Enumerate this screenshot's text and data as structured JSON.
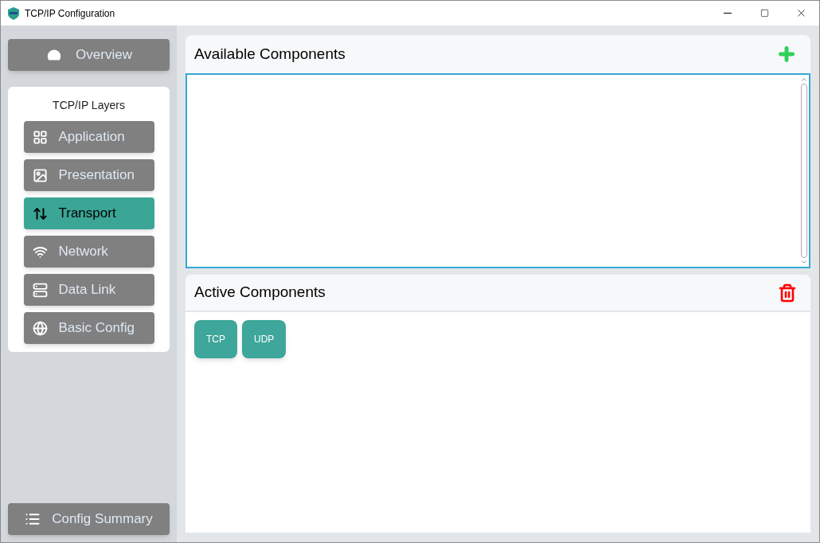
{
  "window": {
    "title": "TCP/IP Configuration"
  },
  "sidebar": {
    "overview": "Overview",
    "layers_title": "TCP/IP Layers",
    "layers": [
      {
        "label": "Application",
        "kind": "grid",
        "selected": false
      },
      {
        "label": "Presentation",
        "kind": "image",
        "selected": false
      },
      {
        "label": "Transport",
        "kind": "arrows",
        "selected": true
      },
      {
        "label": "Network",
        "kind": "wifi",
        "selected": false
      },
      {
        "label": "Data Link",
        "kind": "server",
        "selected": false
      },
      {
        "label": "Basic Config",
        "kind": "globe",
        "selected": false
      }
    ],
    "summary": "Config Summary"
  },
  "available": {
    "title": "Available Components"
  },
  "active": {
    "title": "Active Components",
    "components": [
      "TCP",
      "UDP"
    ]
  }
}
